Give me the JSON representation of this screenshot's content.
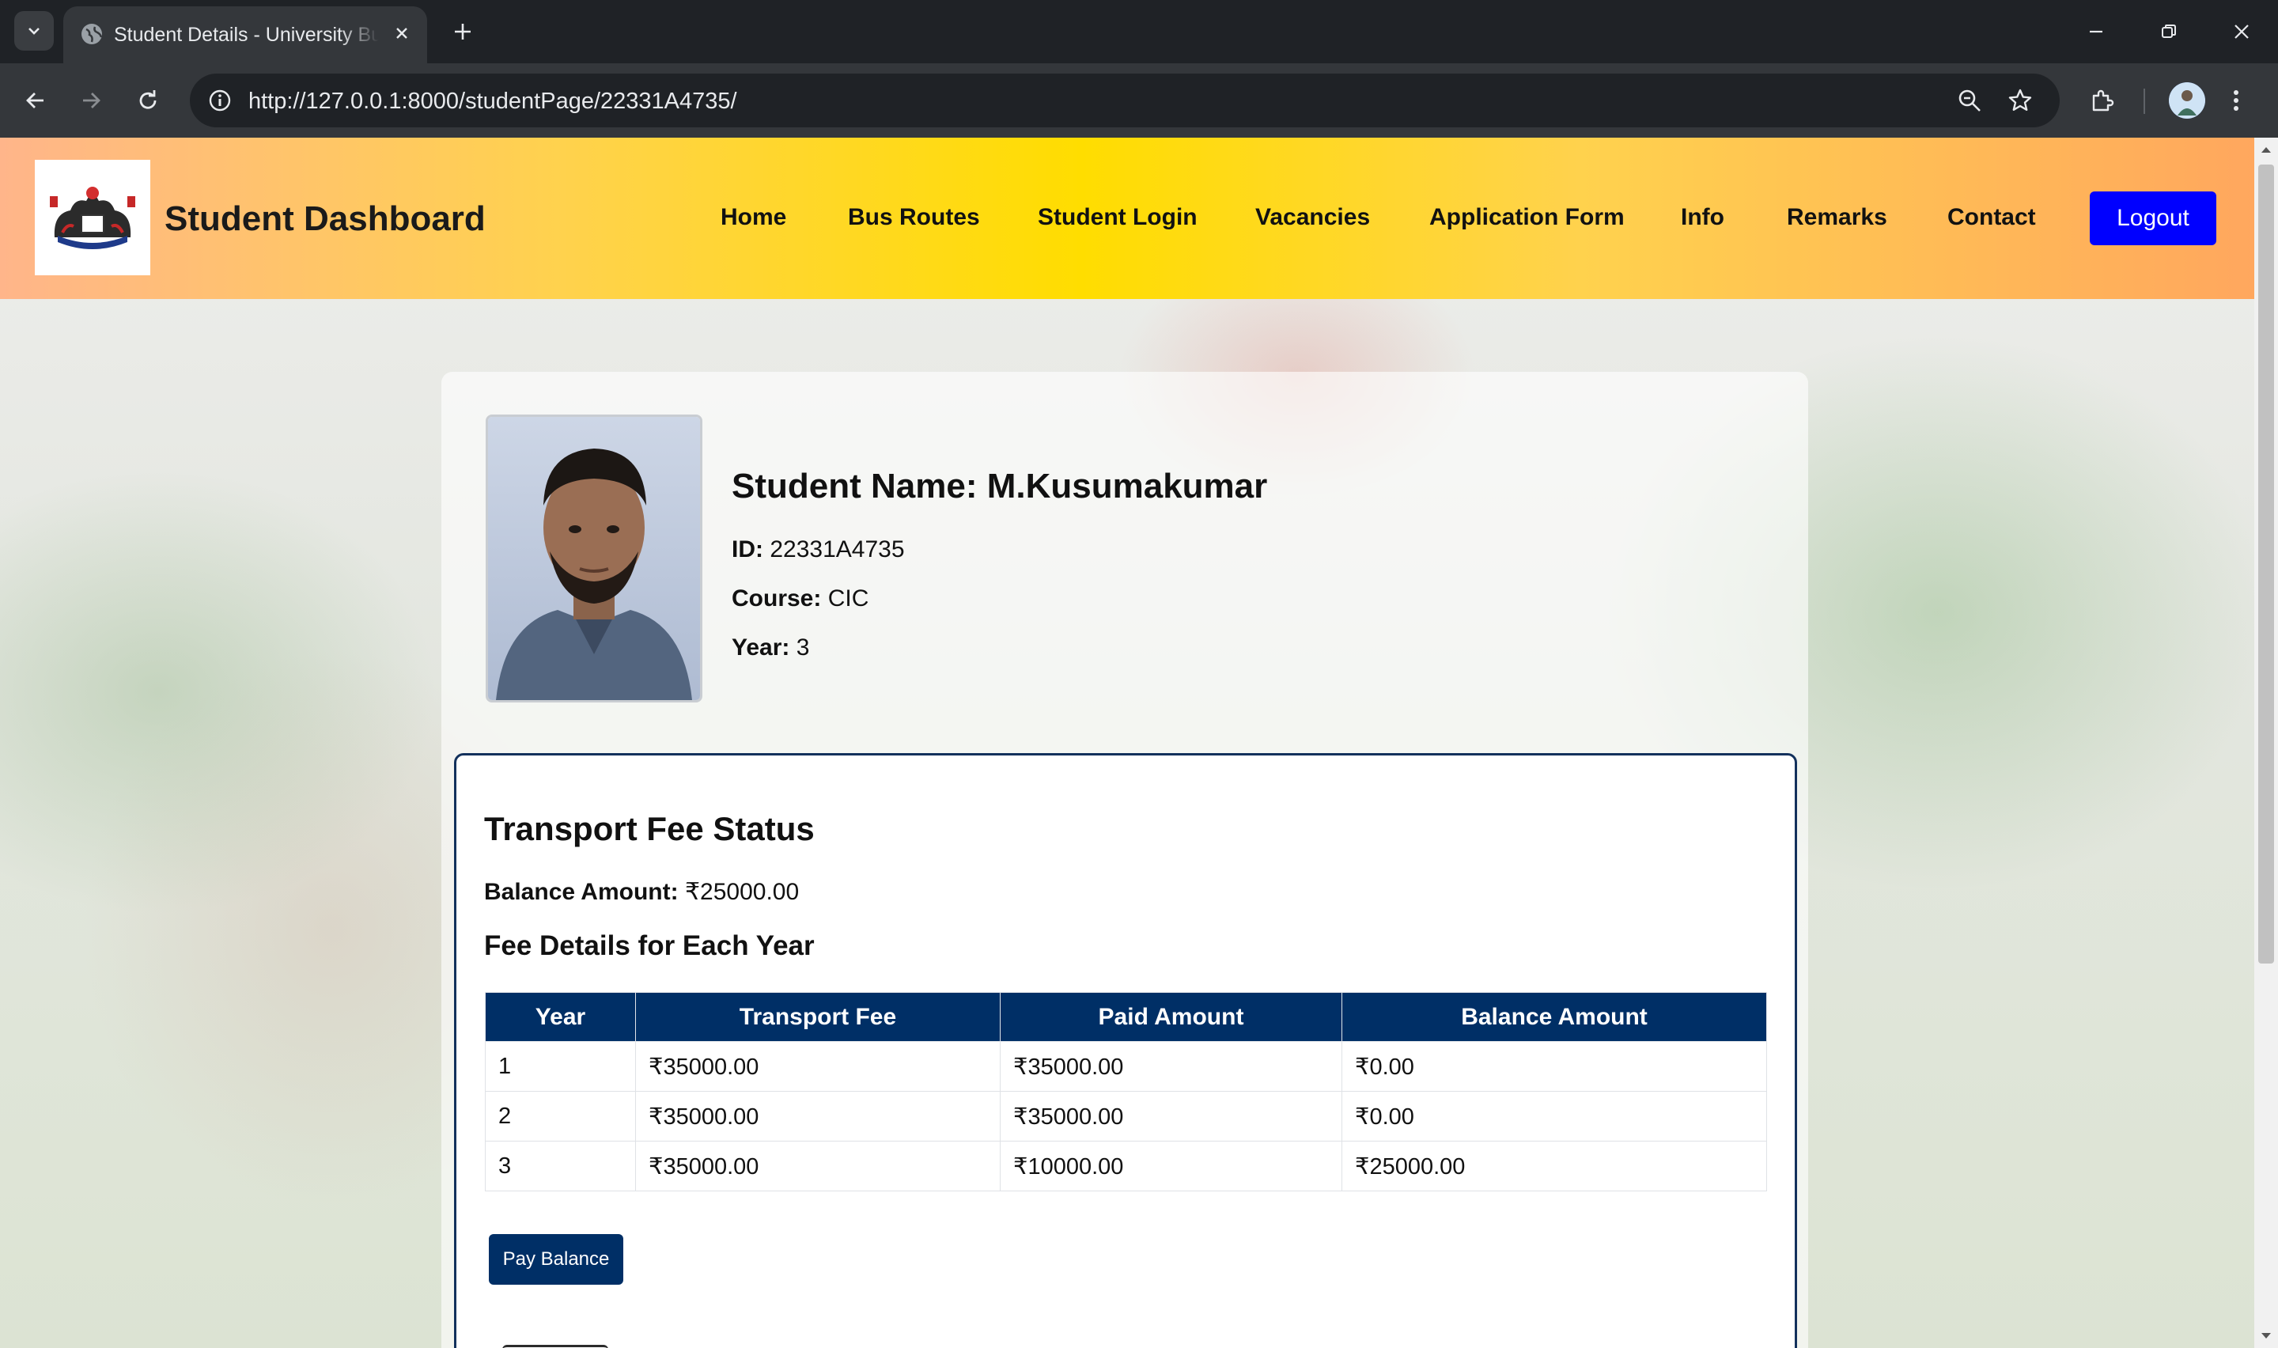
{
  "browser": {
    "tab_title": "Student Details - University Bus",
    "url": "http://127.0.0.1:8000/studentPage/22331A4735/"
  },
  "site": {
    "brand": "Student Dashboard",
    "nav": [
      "Home",
      "Bus Routes",
      "Student Login",
      "Vacancies",
      "Application Form",
      "Info",
      "Remarks",
      "Contact"
    ],
    "logout_label": "Logout"
  },
  "student": {
    "name_label": "Student Name:",
    "name": "M.Kusumakumar",
    "id_label": "ID:",
    "id": "22331A4735",
    "course_label": "Course:",
    "course": "CIC",
    "year_label": "Year:",
    "year": "3"
  },
  "fee": {
    "title": "Transport Fee Status",
    "balance_label": "Balance Amount:",
    "balance": "₹25000.00",
    "details_title": "Fee Details for Each Year",
    "columns": [
      "Year",
      "Transport Fee",
      "Paid Amount",
      "Balance Amount"
    ],
    "rows": [
      [
        "1",
        "₹35000.00",
        "₹35000.00",
        "₹0.00"
      ],
      [
        "2",
        "₹35000.00",
        "₹35000.00",
        "₹0.00"
      ],
      [
        "3",
        "₹35000.00",
        "₹10000.00",
        "₹25000.00"
      ]
    ],
    "pay_label": "Pay Balance"
  },
  "colors": {
    "header_gradient": [
      "#ffb58a",
      "#ffdd00",
      "#ffa75e"
    ],
    "logout_bg": "#0000ff",
    "table_header_bg": "#002f66",
    "panel_border": "#13315c"
  },
  "icons": [
    "tab-search-icon",
    "globe-icon",
    "close-icon",
    "plus-icon",
    "minimize-icon",
    "restore-icon",
    "back-arrow-icon",
    "forward-arrow-icon",
    "reload-icon",
    "site-info-icon",
    "zoom-icon",
    "bookmark-star-icon",
    "extensions-icon",
    "profile-avatar",
    "more-menu-icon"
  ]
}
